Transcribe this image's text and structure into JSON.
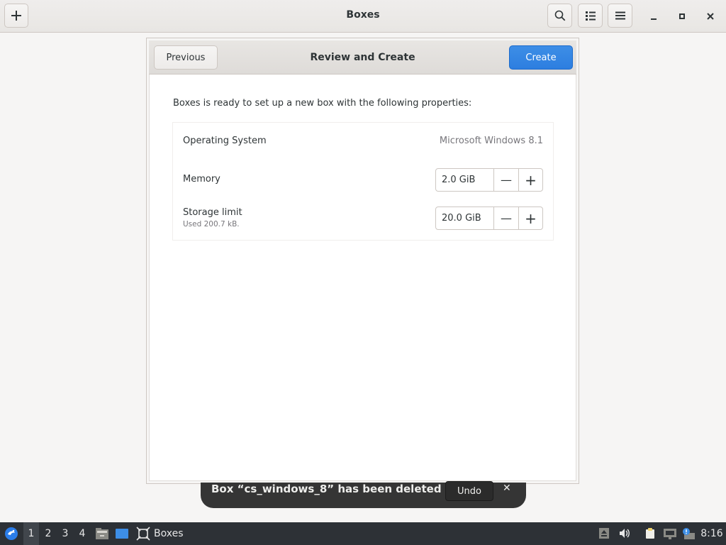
{
  "window": {
    "title": "Boxes",
    "add_icon": "plus-icon",
    "search_icon": "search-icon",
    "view_icon": "list-view-icon",
    "menu_icon": "hamburger-menu-icon",
    "minimize_icon": "minimize-icon",
    "maximize_icon": "maximize-icon",
    "close_icon": "close-icon"
  },
  "dialog": {
    "title": "Review and Create",
    "previous_label": "Previous",
    "create_label": "Create",
    "intro": "Boxes is ready to set up a new box with the following properties:",
    "properties": {
      "os_label": "Operating System",
      "os_value": "Microsoft Windows 8.1",
      "memory_label": "Memory",
      "memory_value": "2.0 GiB",
      "storage_label": "Storage limit",
      "storage_sub": "Used 200.7 kB.",
      "storage_value": "20.0 GiB",
      "decrease_symbol": "—",
      "increase_symbol": "+"
    }
  },
  "notification": {
    "message": "Box “cs_windows_8” has been deleted",
    "undo_label": "Undo",
    "close_symbol": "✕"
  },
  "taskbar": {
    "workspaces": [
      "1",
      "2",
      "3",
      "4"
    ],
    "active_workspace": "1",
    "task_label": "Boxes",
    "clock": "8:16"
  },
  "colors": {
    "accent": "#3584e4",
    "taskbar_bg": "#2d3136",
    "toast_bg": "#353535"
  }
}
